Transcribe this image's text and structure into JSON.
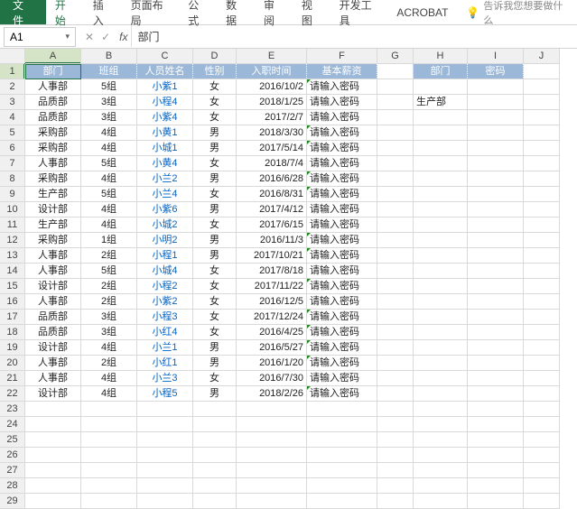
{
  "ribbon": {
    "file": "文件",
    "tabs": [
      "开始",
      "插入",
      "页面布局",
      "公式",
      "数据",
      "审阅",
      "视图",
      "开发工具",
      "ACROBAT"
    ],
    "tellme": "告诉我您想要做什么"
  },
  "namebox": "A1",
  "formula": "部门",
  "columns": [
    "A",
    "B",
    "C",
    "D",
    "E",
    "F",
    "G",
    "H",
    "I",
    "J"
  ],
  "headers": [
    "部门",
    "班组",
    "人员姓名",
    "性别",
    "入职时间",
    "基本薪资"
  ],
  "headers2": [
    "部门",
    "密码"
  ],
  "lookup_value": "生产部",
  "rows": [
    {
      "dept": "人事部",
      "team": "5组",
      "name": "小紫1",
      "gender": "女",
      "date": "2016/10/2",
      "pay": "请输入密码",
      "flag": true
    },
    {
      "dept": "品质部",
      "team": "3组",
      "name": "小程4",
      "gender": "女",
      "date": "2018/1/25",
      "pay": "请输入密码",
      "flag": false
    },
    {
      "dept": "品质部",
      "team": "3组",
      "name": "小紫4",
      "gender": "女",
      "date": "2017/2/7",
      "pay": "请输入密码",
      "flag": false
    },
    {
      "dept": "采购部",
      "team": "4组",
      "name": "小黄1",
      "gender": "男",
      "date": "2018/3/30",
      "pay": "请输入密码",
      "flag": true
    },
    {
      "dept": "采购部",
      "team": "4组",
      "name": "小城1",
      "gender": "男",
      "date": "2017/5/14",
      "pay": "请输入密码",
      "flag": true
    },
    {
      "dept": "人事部",
      "team": "5组",
      "name": "小黄4",
      "gender": "女",
      "date": "2018/7/4",
      "pay": "请输入密码",
      "flag": false
    },
    {
      "dept": "采购部",
      "team": "4组",
      "name": "小兰2",
      "gender": "男",
      "date": "2016/6/28",
      "pay": "请输入密码",
      "flag": true
    },
    {
      "dept": "生产部",
      "team": "5组",
      "name": "小兰4",
      "gender": "女",
      "date": "2016/8/31",
      "pay": "请输入密码",
      "flag": true
    },
    {
      "dept": "设计部",
      "team": "4组",
      "name": "小紫6",
      "gender": "男",
      "date": "2017/4/12",
      "pay": "请输入密码",
      "flag": false
    },
    {
      "dept": "生产部",
      "team": "4组",
      "name": "小城2",
      "gender": "女",
      "date": "2017/6/15",
      "pay": "请输入密码",
      "flag": false
    },
    {
      "dept": "采购部",
      "team": "1组",
      "name": "小明2",
      "gender": "男",
      "date": "2016/11/3",
      "pay": "请输入密码",
      "flag": true
    },
    {
      "dept": "人事部",
      "team": "2组",
      "name": "小程1",
      "gender": "男",
      "date": "2017/10/21",
      "pay": "请输入密码",
      "flag": true
    },
    {
      "dept": "人事部",
      "team": "5组",
      "name": "小城4",
      "gender": "女",
      "date": "2017/8/18",
      "pay": "请输入密码",
      "flag": false
    },
    {
      "dept": "设计部",
      "team": "2组",
      "name": "小程2",
      "gender": "女",
      "date": "2017/11/22",
      "pay": "请输入密码",
      "flag": true
    },
    {
      "dept": "人事部",
      "team": "2组",
      "name": "小紫2",
      "gender": "女",
      "date": "2016/12/5",
      "pay": "请输入密码",
      "flag": false
    },
    {
      "dept": "品质部",
      "team": "3组",
      "name": "小程3",
      "gender": "女",
      "date": "2017/12/24",
      "pay": "请输入密码",
      "flag": true
    },
    {
      "dept": "品质部",
      "team": "3组",
      "name": "小红4",
      "gender": "女",
      "date": "2016/4/25",
      "pay": "请输入密码",
      "flag": true
    },
    {
      "dept": "设计部",
      "team": "4组",
      "name": "小兰1",
      "gender": "男",
      "date": "2016/5/27",
      "pay": "请输入密码",
      "flag": true
    },
    {
      "dept": "人事部",
      "team": "2组",
      "name": "小红1",
      "gender": "男",
      "date": "2016/1/20",
      "pay": "请输入密码",
      "flag": true
    },
    {
      "dept": "人事部",
      "team": "4组",
      "name": "小兰3",
      "gender": "女",
      "date": "2016/7/30",
      "pay": "请输入密码",
      "flag": false
    },
    {
      "dept": "设计部",
      "team": "4组",
      "name": "小程5",
      "gender": "男",
      "date": "2018/2/26",
      "pay": "请输入密码",
      "flag": true
    }
  ],
  "empty_rows": [
    23,
    24,
    25,
    26,
    27,
    28,
    29
  ]
}
